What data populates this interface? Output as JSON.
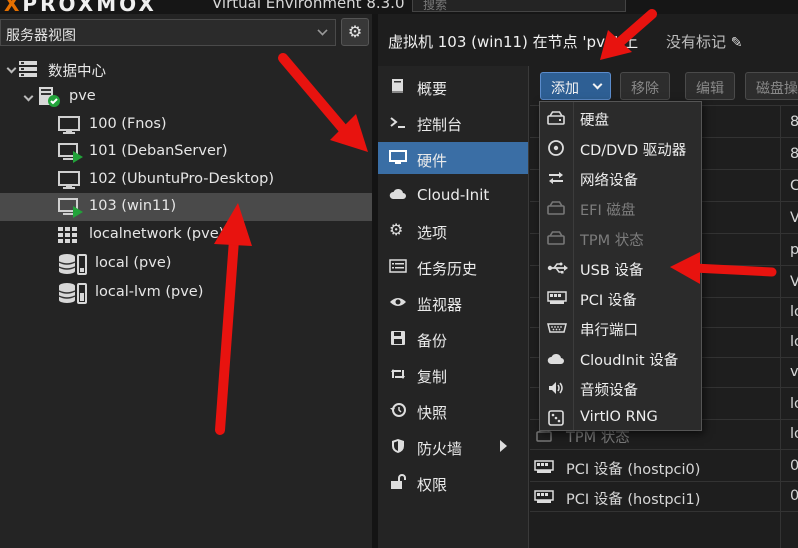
{
  "app": {
    "logo_accent": "X",
    "logo_rest": "PROXMOX",
    "title": "Virtual Environment 8.3.0",
    "search_placeholder": "搜索",
    "brand_color": "#e57000"
  },
  "tree": {
    "view_selector": "服务器视图",
    "items": [
      {
        "label": "数据中心",
        "icon": "datacenter-icon"
      },
      {
        "label": "pve",
        "icon": "node-online-icon"
      },
      {
        "label": "100 (Fnos)",
        "icon": "vm-stopped-icon"
      },
      {
        "label": "101 (DebanServer)",
        "icon": "vm-running-icon"
      },
      {
        "label": "102 (UbuntuPro-Desktop)",
        "icon": "vm-stopped-icon"
      },
      {
        "label": "103 (win11)",
        "icon": "vm-running-icon",
        "selected": true
      },
      {
        "label": "localnetwork (pve)",
        "icon": "network-grid-icon"
      },
      {
        "label": "local (pve)",
        "icon": "storage-icon"
      },
      {
        "label": "local-lvm (pve)",
        "icon": "storage-icon"
      }
    ]
  },
  "header": {
    "vm_title": "虚拟机 103 (win11) 在节点 'pve' 上",
    "no_tags": "没有标记"
  },
  "nav": {
    "items": [
      {
        "label": "概要",
        "icon": "book-icon"
      },
      {
        "label": "控制台",
        "icon": "terminal-icon"
      },
      {
        "label": "硬件",
        "icon": "monitor-icon",
        "active": true
      },
      {
        "label": "Cloud-Init",
        "icon": "cloud-icon"
      },
      {
        "label": "选项",
        "icon": "gear-icon"
      },
      {
        "label": "任务历史",
        "icon": "list-icon"
      },
      {
        "label": "监视器",
        "icon": "eye-icon"
      },
      {
        "label": "备份",
        "icon": "floppy-icon"
      },
      {
        "label": "复制",
        "icon": "retweet-icon"
      },
      {
        "label": "快照",
        "icon": "history-icon"
      },
      {
        "label": "防火墙",
        "icon": "shield-icon"
      },
      {
        "label": "权限",
        "icon": "unlock-icon"
      }
    ]
  },
  "toolbar": {
    "add": "添加",
    "remove": "移除",
    "edit": "编辑",
    "disk_action": "磁盘操作"
  },
  "hardware": {
    "rows_behind": [
      {
        "label": "",
        "value": "8"
      },
      {
        "label": "",
        "value": "8"
      },
      {
        "label": "",
        "value": "C"
      },
      {
        "label": "",
        "value": "V"
      },
      {
        "label": "",
        "value": "p"
      },
      {
        "label": "",
        "value": "V"
      },
      {
        "label": "",
        "value": "lo"
      },
      {
        "label": "",
        "value": "lo"
      },
      {
        "label": "",
        "value": "v"
      },
      {
        "label": "",
        "value": "lo"
      },
      {
        "label": "",
        "value": "lo"
      },
      {
        "label": "TPM 状态",
        "value": "lo"
      },
      {
        "label": "PCI 设备 (hostpci0)",
        "value": "0"
      },
      {
        "label": "PCI 设备 (hostpci1)",
        "value": "0"
      }
    ]
  },
  "add_menu": {
    "items": [
      {
        "label": "硬盘",
        "icon": "hdd-icon",
        "disabled": false
      },
      {
        "label": "CD/DVD 驱动器",
        "icon": "cdrom-icon",
        "disabled": false
      },
      {
        "label": "网络设备",
        "icon": "exchange-icon",
        "disabled": false
      },
      {
        "label": "EFI 磁盘",
        "icon": "hdd-icon",
        "disabled": true
      },
      {
        "label": "TPM 状态",
        "icon": "hdd-icon",
        "disabled": true
      },
      {
        "label": "USB 设备",
        "icon": "usb-icon",
        "disabled": false
      },
      {
        "label": "PCI 设备",
        "icon": "pci-card-icon",
        "disabled": false
      },
      {
        "label": "串行端口",
        "icon": "serial-port-icon",
        "disabled": false
      },
      {
        "label": "CloudInit 设备",
        "icon": "cloud-icon",
        "disabled": false
      },
      {
        "label": "音频设备",
        "icon": "volume-icon",
        "disabled": false
      },
      {
        "label": "VirtIO RNG",
        "icon": "dice-icon",
        "disabled": false
      }
    ]
  },
  "annotation_color": "#e8130f"
}
